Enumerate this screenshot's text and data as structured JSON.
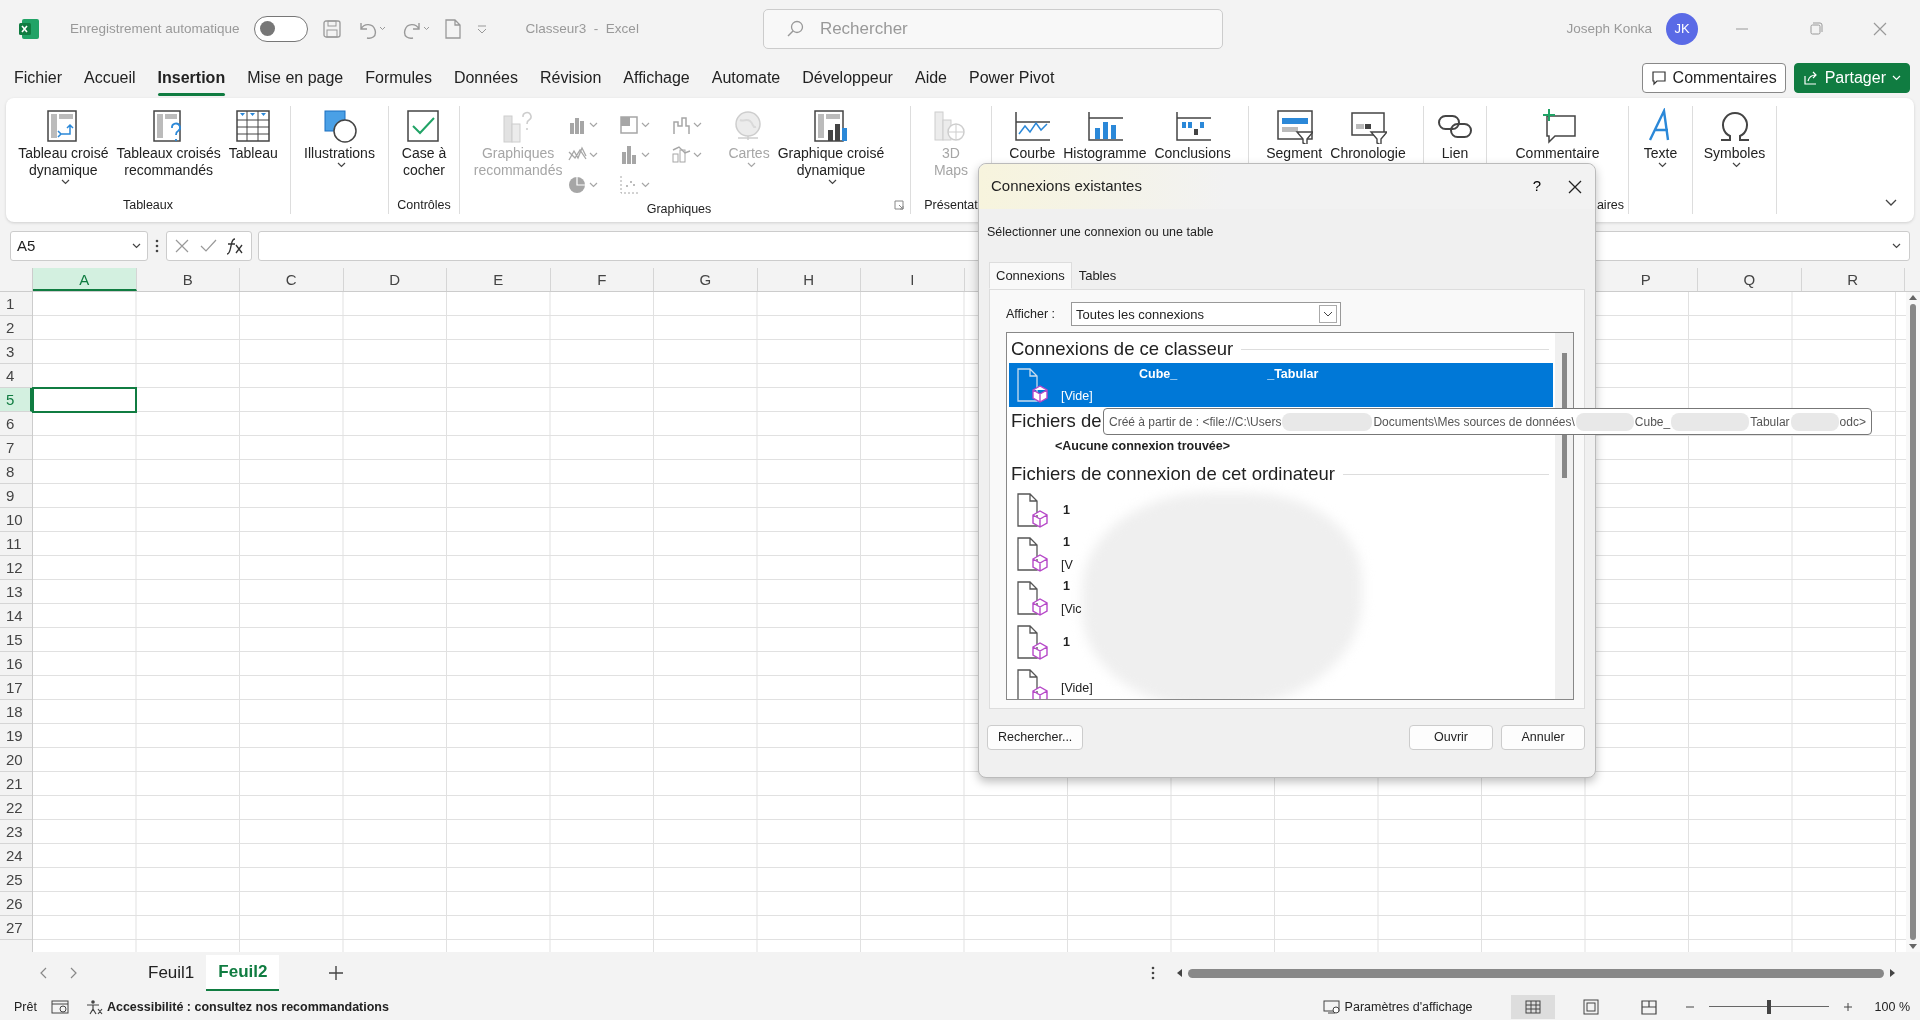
{
  "title_bar": {
    "autosave_label": "Enregistrement automatique",
    "autosave_on": false,
    "document_title": "Classeur3  -  Excel",
    "search": {
      "placeholder": "Rechercher"
    },
    "user_name": "Joseph Konka",
    "user_initials": "JK"
  },
  "menu_tabs": [
    {
      "label": "Fichier",
      "selected": false
    },
    {
      "label": "Accueil",
      "selected": false
    },
    {
      "label": "Insertion",
      "selected": true
    },
    {
      "label": "Mise en page",
      "selected": false
    },
    {
      "label": "Formules",
      "selected": false
    },
    {
      "label": "Données",
      "selected": false
    },
    {
      "label": "Révision",
      "selected": false
    },
    {
      "label": "Affichage",
      "selected": false
    },
    {
      "label": "Automate",
      "selected": false
    },
    {
      "label": "Développeur",
      "selected": false
    },
    {
      "label": "Aide",
      "selected": false
    },
    {
      "label": "Power Pivot",
      "selected": false
    }
  ],
  "header_buttons": [
    {
      "label": "Commentaires",
      "kind": "outline"
    },
    {
      "label": "Partager",
      "kind": "primary"
    }
  ],
  "ribbon_groups": [
    {
      "label": "Tableaux",
      "items": [
        {
          "kind": "pivot",
          "label": "Tableau croisé\ndynamique",
          "dropdown": true,
          "disabled": false
        },
        {
          "kind": "recpivot",
          "label": "Tableaux croisés\nrecommandés",
          "dropdown": false,
          "disabled": false
        },
        {
          "kind": "table",
          "label": "Tableau",
          "dropdown": false,
          "disabled": false
        }
      ]
    },
    {
      "items": [
        {
          "kind": "shapes",
          "label": "Illustrations",
          "dropdown": true,
          "disabled": false
        }
      ]
    },
    {
      "label": "Contrôles",
      "items": [
        {
          "kind": "checkbox",
          "label": "Case à\ncocher",
          "dropdown": false,
          "disabled": false
        }
      ]
    },
    {
      "label": "Graphiques",
      "launcher": true,
      "items": [
        {
          "kind": "recchart",
          "label": "Graphiques\nrecommandés",
          "dropdown": false,
          "disabled": true
        },
        {
          "kind": "gallery",
          "disabled": true
        },
        {
          "kind": "globe",
          "label": "Cartes",
          "dropdown": true,
          "disabled": true
        },
        {
          "kind": "pivotchart",
          "label": "Graphique croisé\ndynamique",
          "dropdown": true,
          "disabled": false
        }
      ]
    },
    {
      "label": "Présentat",
      "items": [
        {
          "kind": "maps",
          "label": "3D\nMaps",
          "dropdown": false,
          "disabled": true
        }
      ]
    },
    {
      "items": [
        {
          "kind": "line",
          "label": "Courbe",
          "dropdown": false,
          "disabled": false
        },
        {
          "kind": "column",
          "label": "Histogramme",
          "dropdown": false,
          "disabled": false
        },
        {
          "kind": "winloss",
          "label": "Conclusions",
          "dropdown": false,
          "disabled": false
        }
      ]
    },
    {
      "items": [
        {
          "kind": "slicer",
          "label": "Segment",
          "dropdown": false,
          "disabled": false
        },
        {
          "kind": "timeline",
          "label": "Chronologie",
          "dropdown": false,
          "disabled": false
        }
      ]
    },
    {
      "items": [
        {
          "kind": "link",
          "label": "Lien",
          "dropdown": false,
          "disabled": false
        }
      ]
    },
    {
      "label": "aires",
      "items": [
        {
          "kind": "comment",
          "label": "Commentaire",
          "dropdown": false,
          "disabled": false
        }
      ]
    },
    {
      "items": [
        {
          "kind": "text",
          "label": "Texte",
          "dropdown": true,
          "disabled": false
        }
      ]
    },
    {
      "items": [
        {
          "kind": "omega",
          "label": "Symboles",
          "dropdown": true,
          "disabled": false
        }
      ]
    }
  ],
  "formula_bar": {
    "name_box": "A5"
  },
  "sheet": {
    "columns_left": [
      {
        "label": "A",
        "selected": true
      },
      {
        "label": "B",
        "selected": false
      },
      {
        "label": "C",
        "selected": false
      },
      {
        "label": "D",
        "selected": false
      },
      {
        "label": "E",
        "selected": false
      },
      {
        "label": "F",
        "selected": false
      },
      {
        "label": "G",
        "selected": false
      },
      {
        "label": "H",
        "selected": false
      },
      {
        "label": "I",
        "selected": false
      }
    ],
    "columns_right": [
      {
        "label": "P",
        "selected": false
      },
      {
        "label": "Q",
        "selected": false
      },
      {
        "label": "R",
        "selected": false
      }
    ],
    "rows": [
      {
        "label": "1",
        "selected": false
      },
      {
        "label": "2",
        "selected": false
      },
      {
        "label": "3",
        "selected": false
      },
      {
        "label": "4",
        "selected": false
      },
      {
        "label": "5",
        "selected": true
      },
      {
        "label": "6",
        "selected": false
      },
      {
        "label": "7",
        "selected": false
      },
      {
        "label": "8",
        "selected": false
      },
      {
        "label": "9",
        "selected": false
      },
      {
        "label": "10",
        "selected": false
      },
      {
        "label": "11",
        "selected": false
      },
      {
        "label": "12",
        "selected": false
      },
      {
        "label": "13",
        "selected": false
      },
      {
        "label": "14",
        "selected": false
      },
      {
        "label": "15",
        "selected": false
      },
      {
        "label": "16",
        "selected": false
      },
      {
        "label": "17",
        "selected": false
      },
      {
        "label": "18",
        "selected": false
      },
      {
        "label": "19",
        "selected": false
      },
      {
        "label": "20",
        "selected": false
      },
      {
        "label": "21",
        "selected": false
      },
      {
        "label": "22",
        "selected": false
      },
      {
        "label": "23",
        "selected": false
      },
      {
        "label": "24",
        "selected": false
      },
      {
        "label": "25",
        "selected": false
      },
      {
        "label": "26",
        "selected": false
      },
      {
        "label": "27",
        "selected": false
      }
    ]
  },
  "sheet_tabs": [
    {
      "label": "Feuil1",
      "selected": false
    },
    {
      "label": "Feuil2",
      "selected": true
    }
  ],
  "status_bar": {
    "ready": "Prêt",
    "accessibility": "Accessibilité : consultez nos recommandations",
    "display_settings": "Paramètres d'affichage",
    "views": [
      {
        "kind": "normal",
        "selected": true
      },
      {
        "kind": "layout",
        "selected": false
      },
      {
        "kind": "breaks",
        "selected": false
      }
    ],
    "zoom": {
      "level": 0.5,
      "reading": "100 %"
    }
  },
  "dialog": {
    "title": "Connexions existantes",
    "help": "?",
    "instruction": "Sélectionner une connexion ou une table",
    "tabs": [
      {
        "label": "Connexions",
        "selected": true
      },
      {
        "label": "Tables",
        "selected": false
      }
    ],
    "show_label": "Afficher :",
    "show_value": "Toutes les connexions",
    "sections": [
      {
        "heading": "Connexions de ce classeur",
        "items": [
          {
            "kind": "connection",
            "title_parts": [
              "Cube_",
              "_Tabular"
            ],
            "subtitle": "[Vide]",
            "selected": true
          }
        ]
      },
      {
        "heading": "Fichiers de",
        "items": [
          {
            "kind": "empty",
            "text": "<Aucune connexion trouvée>"
          }
        ]
      },
      {
        "heading": "Fichiers de connexion de cet ordinateur",
        "items": [
          {
            "kind": "connection",
            "title_parts": [
              "1"
            ],
            "selected": false
          },
          {
            "kind": "connection",
            "title_parts": [
              "1"
            ],
            "subtitle": "[V",
            "selected": false
          },
          {
            "kind": "connection",
            "title_parts": [
              "1"
            ],
            "subtitle": "[Vic",
            "selected": false
          },
          {
            "kind": "connection",
            "title_parts": [
              "1"
            ],
            "selected": false
          },
          {
            "kind": "connection",
            "subtitle": "[Vide]",
            "selected": false
          }
        ]
      }
    ],
    "buttons": [
      {
        "label": "Rechercher...",
        "kind": "left"
      },
      {
        "label": "Ouvrir",
        "kind": "right"
      },
      {
        "label": "Annuler",
        "kind": "right"
      }
    ],
    "tooltip": {
      "segments": [
        "Créé à partir de : <file://C:\\Users",
        "Documents\\Mes sources de données\\",
        "Cube_",
        "Tabular",
        "odc>"
      ]
    }
  }
}
